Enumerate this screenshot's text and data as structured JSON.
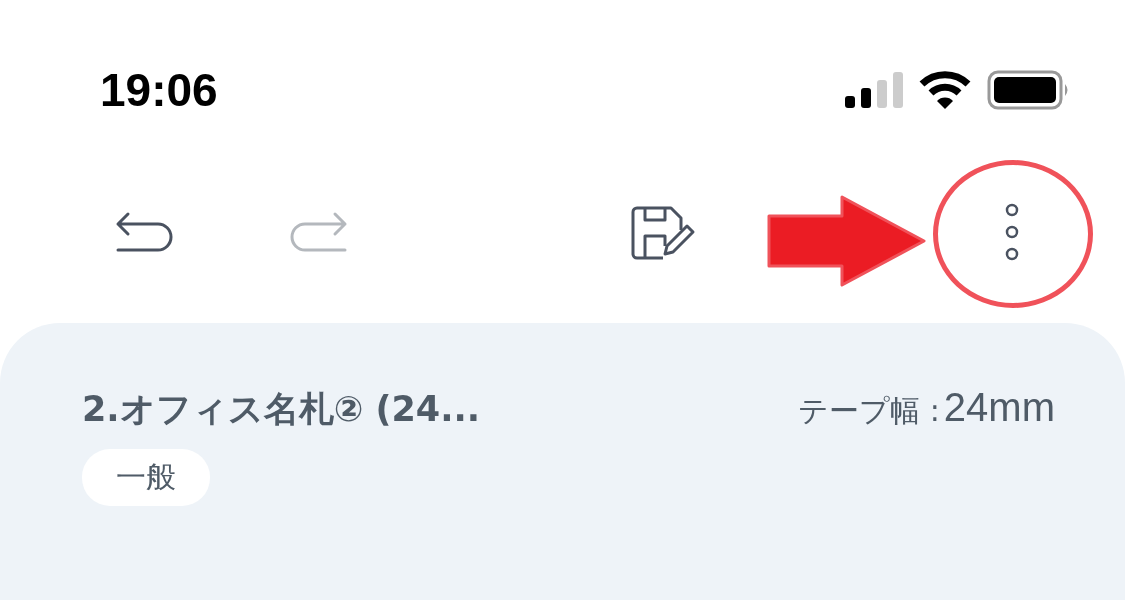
{
  "status_bar": {
    "time": "19:06"
  },
  "toolbar": [
    {
      "kind": "undo",
      "disabled": false
    },
    {
      "kind": "redo",
      "disabled": true
    },
    {
      "kind": "save-edit",
      "disabled": false
    },
    {
      "kind": "more",
      "disabled": false
    }
  ],
  "card": {
    "title": "2.オフィス名札② (24...",
    "tape_width_label": "テープ幅 :",
    "tape_width_value": "24mm",
    "tag": "一般"
  }
}
